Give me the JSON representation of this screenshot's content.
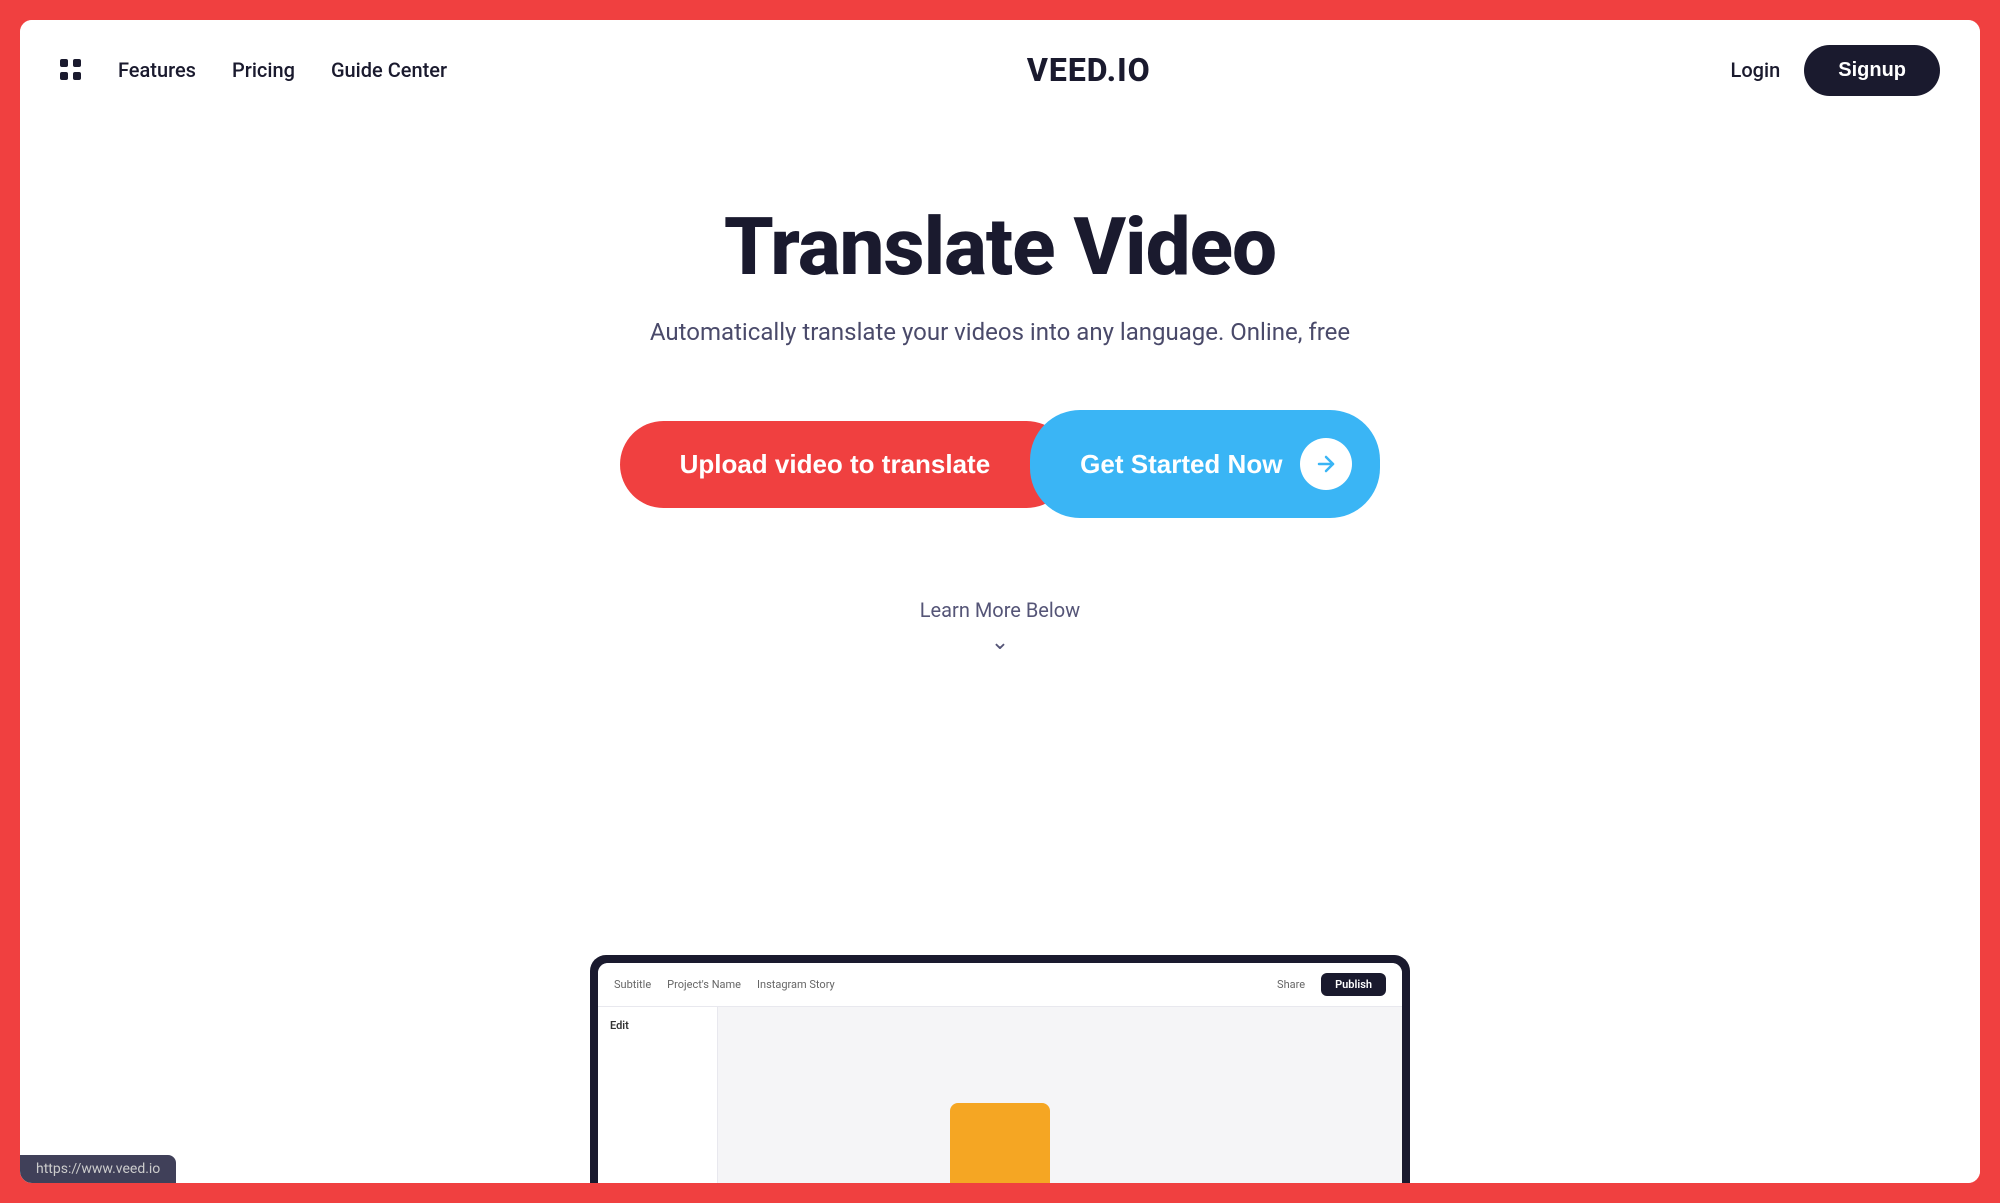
{
  "page": {
    "background_color": "#f04040",
    "frame_background": "#ffffff"
  },
  "navbar": {
    "features_label": "Features",
    "pricing_label": "Pricing",
    "guide_center_label": "Guide Center",
    "logo": "VEED.IO",
    "login_label": "Login",
    "signup_label": "Signup"
  },
  "hero": {
    "title": "Translate Video",
    "subtitle": "Automatically translate your videos into any language. Online, free",
    "upload_btn_label": "Upload video to translate",
    "get_started_label": "Get Started Now",
    "learn_more_label": "Learn More Below"
  },
  "app_mock": {
    "subtitle_label": "Subtitle",
    "project_name": "Project's Name",
    "instagram_story": "Instagram Story",
    "share_label": "Share",
    "publish_label": "Publish",
    "edit_label": "Edit"
  },
  "url_bar": {
    "url": "https://www.veed.io"
  },
  "icons": {
    "grid": "grid-icon",
    "arrow_right": "arrow-right-icon",
    "chevron_down": "chevron-down-icon"
  }
}
